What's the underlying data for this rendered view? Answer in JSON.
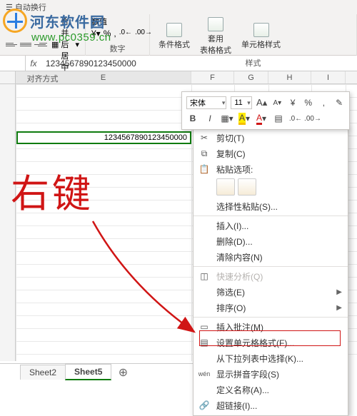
{
  "ribbon": {
    "autowrap": "自动换行",
    "mergecenter": "合并后居中",
    "group_align": "对齐方式",
    "numfmt": "数值",
    "group_number": "数字",
    "cond_format": "条件格式",
    "table_format": "套用\n表格格式",
    "cell_style": "单元格样式",
    "group_style": "样式"
  },
  "watermark": {
    "title": "河东软件园",
    "url": "www.pc0359.cn"
  },
  "formula": {
    "fx": "fx",
    "value": "1234567890123450000"
  },
  "columns": {
    "E": "E",
    "F": "F",
    "G": "G",
    "H": "H",
    "I": "I"
  },
  "cell": {
    "value": "1234567890123450000"
  },
  "miniToolbar": {
    "font": "宋体",
    "size": "11"
  },
  "ctx": {
    "cut": "剪切(T)",
    "copy": "复制(C)",
    "paste_header": "粘贴选项:",
    "paste_special": "选择性粘贴(S)...",
    "insert": "插入(I)...",
    "delete": "删除(D)...",
    "clear": "清除内容(N)",
    "quick": "快速分析(Q)",
    "filter": "筛选(E)",
    "sort": "排序(O)",
    "comment": "插入批注(M)",
    "format": "设置单元格格式(F)...",
    "dropdown": "从下拉列表中选择(K)...",
    "phonetic": "显示拼音字段(S)",
    "name": "定义名称(A)...",
    "hyperlink": "超链接(I)..."
  },
  "tabs": {
    "sheet2": "Sheet2",
    "sheet5": "Sheet5"
  },
  "annotation": "右键"
}
